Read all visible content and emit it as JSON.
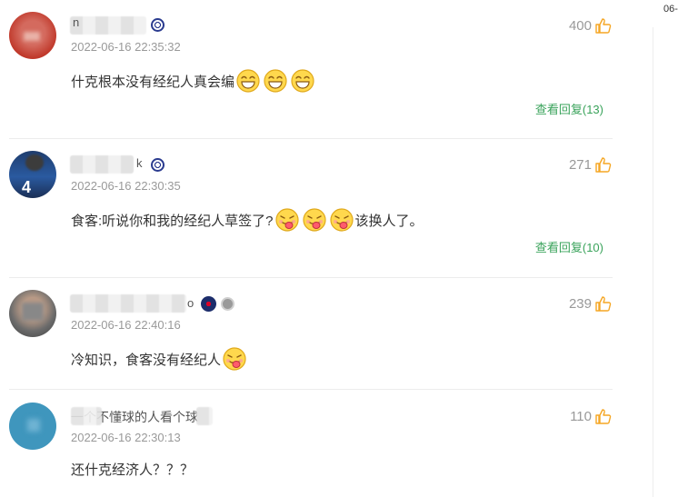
{
  "corner_date": "06-",
  "comments": [
    {
      "name_visible": "n",
      "time": "2022-06-16 22:35:32",
      "likes": "400",
      "text_before": "什克根本没有经纪人真会编",
      "text_after": "",
      "emoji_count": 3,
      "emoji_type": "grin",
      "reply_label": "查看回复(13)"
    },
    {
      "name_visible": "k",
      "time": "2022-06-16 22:30:35",
      "likes": "271",
      "text_before": "食客:听说你和我的经纪人草签了?",
      "text_after": "该换人了。",
      "emoji_count": 3,
      "emoji_type": "tongue",
      "reply_label": "查看回复(10)"
    },
    {
      "name_visible": "o",
      "time": "2022-06-16 22:40:16",
      "likes": "239",
      "text_before": "冷知识，食客没有经纪人",
      "text_after": "",
      "emoji_count": 1,
      "emoji_type": "tongue",
      "reply_label": ""
    },
    {
      "name_visible": "一个不懂球的人看个球",
      "time": "2022-06-16 22:30:13",
      "likes": "110",
      "text_before": "还什克经济人？？？",
      "text_after": "",
      "emoji_count": 0,
      "emoji_type": "",
      "reply_label": ""
    }
  ],
  "colors": {
    "link": "#3aa35b",
    "like_icon": "#f5a623",
    "time": "#999999"
  }
}
